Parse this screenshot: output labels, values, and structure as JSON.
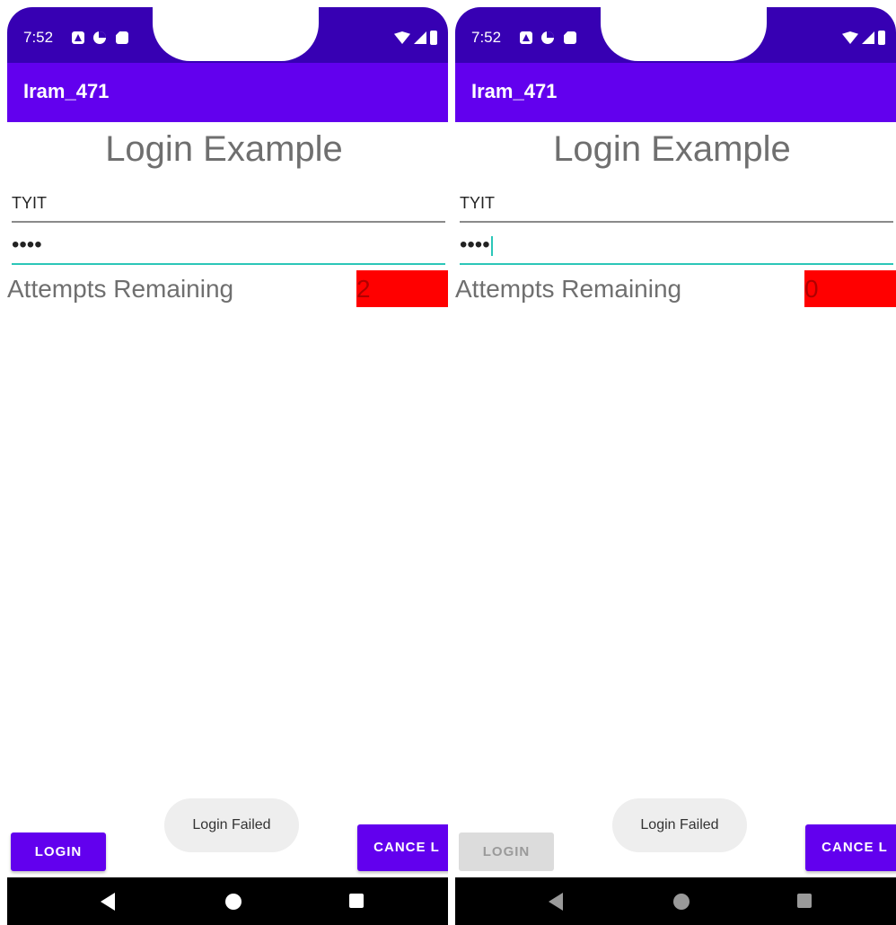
{
  "screens": [
    {
      "status": {
        "time": "7:52"
      },
      "app_title": "Iram_471",
      "heading": "Login Example",
      "username_value": "TYIT",
      "password_masked": "••••",
      "attempts_label": "Attempts Remaining",
      "attempts_value": "2",
      "toast": "Login Failed",
      "login_label": "LOGIN",
      "login_enabled": true,
      "cancel_label": "CANCE L"
    },
    {
      "status": {
        "time": "7:52"
      },
      "app_title": "Iram_471",
      "heading": "Login Example",
      "username_value": "TYIT",
      "password_masked": "••••",
      "attempts_label": "Attempts Remaining",
      "attempts_value": "0",
      "toast": "Login Failed",
      "login_label": "LOGIN",
      "login_enabled": false,
      "cancel_label": "CANCE L"
    }
  ],
  "colors": {
    "status_bar": "#3700b3",
    "app_bar": "#6200ee",
    "attempts_box": "#ff0000",
    "focus_underline": "#2bc6b8"
  },
  "icons": [
    "a-notification-icon",
    "data-saver-icon",
    "sd-card-icon",
    "wifi-icon",
    "signal-icon",
    "battery-icon",
    "back-icon",
    "home-icon",
    "recents-icon"
  ]
}
